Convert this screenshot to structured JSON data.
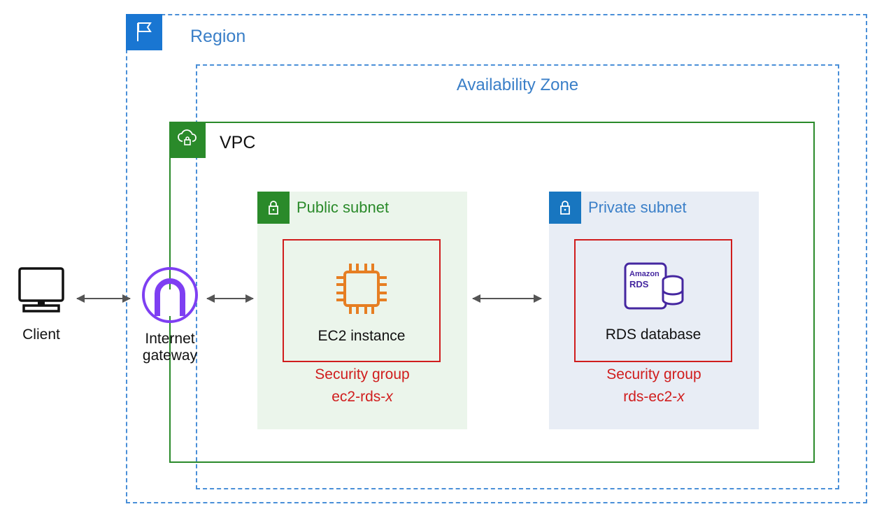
{
  "region": {
    "label": "Region"
  },
  "az": {
    "label": "Availability Zone"
  },
  "vpc": {
    "label": "VPC"
  },
  "publicSubnet": {
    "label": "Public subnet",
    "resourceLabel": "EC2 instance",
    "sgTitle": "Security group",
    "sgNamePrefix": "ec2-rds-",
    "sgNameSuffix": "x"
  },
  "privateSubnet": {
    "label": "Private subnet",
    "resourceLabel": "RDS database",
    "sgTitle": "Security group",
    "sgNamePrefix": "rds-ec2-",
    "sgNameSuffix": "x",
    "iconText1": "Amazon",
    "iconText2": "RDS"
  },
  "client": {
    "label": "Client"
  },
  "igw": {
    "labelLine1": "Internet",
    "labelLine2": "gateway"
  }
}
